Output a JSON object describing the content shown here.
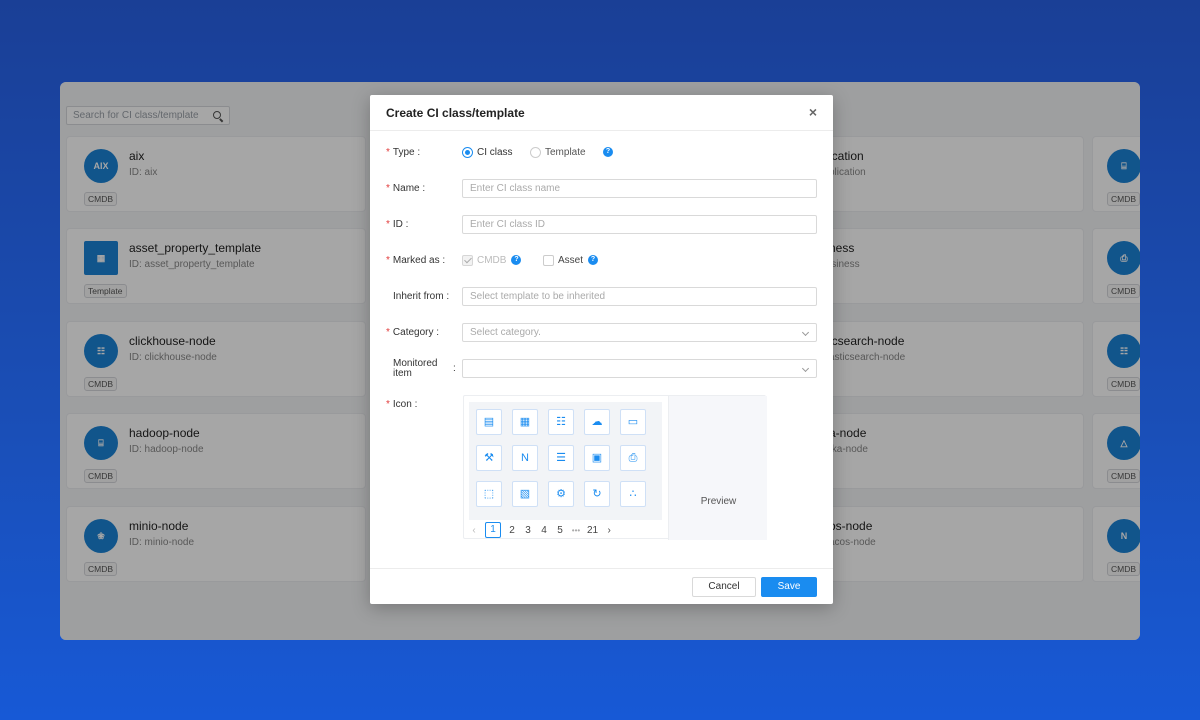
{
  "background": {
    "search_placeholder": "Search for CI class/template"
  },
  "cards_left": [
    {
      "name": "aix",
      "id": "ID: aix",
      "tag": "CMDB",
      "icon": "aix-logo-icon",
      "icon_text": "AIX"
    },
    {
      "name": "asset_property_template",
      "id": "ID:  asset_property_template",
      "tag": "Template",
      "icon": "grid-squares-icon",
      "icon_text": "▦"
    },
    {
      "name": "clickhouse-node",
      "id": "ID: clickhouse-node",
      "tag": "CMDB",
      "icon": "cluster-icon",
      "icon_text": "☷"
    },
    {
      "name": "hadoop-node",
      "id": "ID: hadoop-node",
      "tag": "CMDB",
      "icon": "server-icon",
      "icon_text": "⌸"
    },
    {
      "name": "minio-node",
      "id": "ID: minio-node",
      "tag": "CMDB",
      "icon": "minio-icon",
      "icon_text": "❀"
    }
  ],
  "cards_right": [
    {
      "name": "ication",
      "id": "plication"
    },
    {
      "name": "ness",
      "id": "isiness"
    },
    {
      "name": "icsearch-node",
      "id": "asticsearch-node"
    },
    {
      "name": "a-node",
      "id": "fka-node"
    },
    {
      "name": "os-node",
      "id": "acos-node"
    }
  ],
  "cards_far_right": [
    {
      "tag": "CMDB",
      "icon": "database-icon",
      "icon_text": "⌸"
    },
    {
      "tag": "CMDB",
      "icon": "printer-icon",
      "icon_text": "⎙"
    },
    {
      "tag": "CMDB",
      "icon": "cluster-icon",
      "icon_text": "☷"
    },
    {
      "tag": "CMDB",
      "icon": "linux-penguin-icon",
      "icon_text": "△"
    },
    {
      "tag": "CMDB",
      "icon": "nacos-n-icon",
      "icon_text": "N"
    }
  ],
  "modal": {
    "title": "Create CI class/template",
    "close": "×",
    "type_label": "Type",
    "type_options": [
      "CI class",
      "Template"
    ],
    "type_selected": "CI class",
    "name_label": "Name",
    "name_placeholder": "Enter CI class name",
    "id_label": "ID",
    "id_placeholder": "Enter CI class ID",
    "marked_label": "Marked as",
    "marked_options": [
      {
        "label": "CMDB",
        "checked": true,
        "disabled": true
      },
      {
        "label": "Asset",
        "checked": false,
        "disabled": false
      }
    ],
    "inherit_label": "Inherit from",
    "inherit_placeholder": "Select template to be inherited",
    "category_label": "Category",
    "category_placeholder": "Select category.",
    "monitored_label_line1": "Monitored",
    "monitored_label_line2": "item",
    "monitored_value": "",
    "icon_label": "Icon",
    "icons": [
      {
        "name": "server-rack-icon",
        "glyph": "▤"
      },
      {
        "name": "grid-squares-icon",
        "glyph": "▦"
      },
      {
        "name": "hierarchy-icon",
        "glyph": "☷"
      },
      {
        "name": "cloud-icon",
        "glyph": "☁"
      },
      {
        "name": "window-icon",
        "glyph": "▭"
      },
      {
        "name": "tools-icon",
        "glyph": "⚒"
      },
      {
        "name": "nacos-n-icon",
        "glyph": "N"
      },
      {
        "name": "barcode-icon",
        "glyph": "☰"
      },
      {
        "name": "monitor-grid-icon",
        "glyph": "▣"
      },
      {
        "name": "printer-icon",
        "glyph": "⎙"
      },
      {
        "name": "scan-frame-icon",
        "glyph": "⬚"
      },
      {
        "name": "document-icon",
        "glyph": "▧"
      },
      {
        "name": "gear-icon",
        "glyph": "⚙"
      },
      {
        "name": "cloud-sync-icon",
        "glyph": "↻"
      },
      {
        "name": "triangle-cluster-icon",
        "glyph": "∴"
      }
    ],
    "preview_label": "Preview",
    "pagination": {
      "prev": "‹",
      "pages": [
        "1",
        "2",
        "3",
        "4",
        "5"
      ],
      "ellipsis": "•••",
      "last": "21",
      "next": "›",
      "current": "1"
    },
    "cancel_label": "Cancel",
    "save_label": "Save"
  },
  "colors": {
    "accent": "#1a8cf0",
    "required": "#e23b3b",
    "card_icon": "#1b83d6"
  }
}
